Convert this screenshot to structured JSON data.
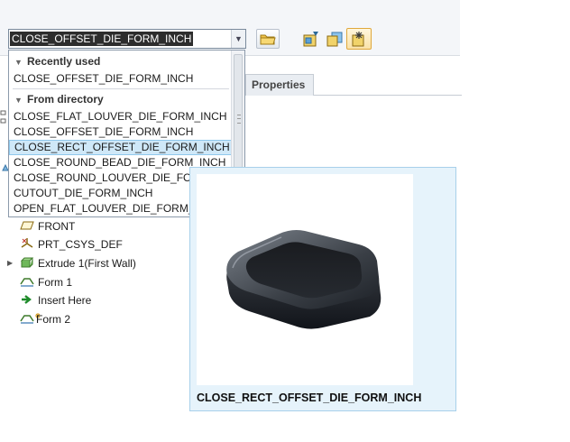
{
  "combo": {
    "value": "CLOSE_OFFSET_DIE_FORM_INCH",
    "arrow_icon": "chevron-down-icon"
  },
  "toolbar": {
    "icons": [
      "open-folder-icon",
      "edit-placement-icon",
      "reference-icon",
      "insert-feature-icon"
    ]
  },
  "tabs": {
    "properties": "Properties"
  },
  "dropdown": {
    "recent_header": "Recently used",
    "recent_items": [
      "CLOSE_OFFSET_DIE_FORM_INCH"
    ],
    "dir_header": "From directory",
    "dir_items": [
      "CLOSE_FLAT_LOUVER_DIE_FORM_INCH",
      "CLOSE_OFFSET_DIE_FORM_INCH",
      "CLOSE_RECT_OFFSET_DIE_FORM_INCH",
      "CLOSE_ROUND_BEAD_DIE_FORM_INCH",
      "CLOSE_ROUND_LOUVER_DIE_FORM_INCH",
      "CUTOUT_DIE_FORM_INCH",
      "OPEN_FLAT_LOUVER_DIE_FORM_INCH"
    ],
    "selected_index": 2
  },
  "tree": {
    "items": [
      {
        "label": "FRONT",
        "icon": "datum-plane-icon"
      },
      {
        "label": "PRT_CSYS_DEF",
        "icon": "coordinate-system-icon"
      },
      {
        "label": "Extrude 1(First Wall)",
        "icon": "extrude-icon"
      },
      {
        "label": "Form 1",
        "icon": "form-icon"
      },
      {
        "label": "Insert Here",
        "icon": "insert-arrow-icon"
      },
      {
        "label": "Form 2",
        "icon": "form-new-icon"
      }
    ]
  },
  "preview": {
    "caption": "CLOSE_RECT_OFFSET_DIE_FORM_INCH"
  }
}
